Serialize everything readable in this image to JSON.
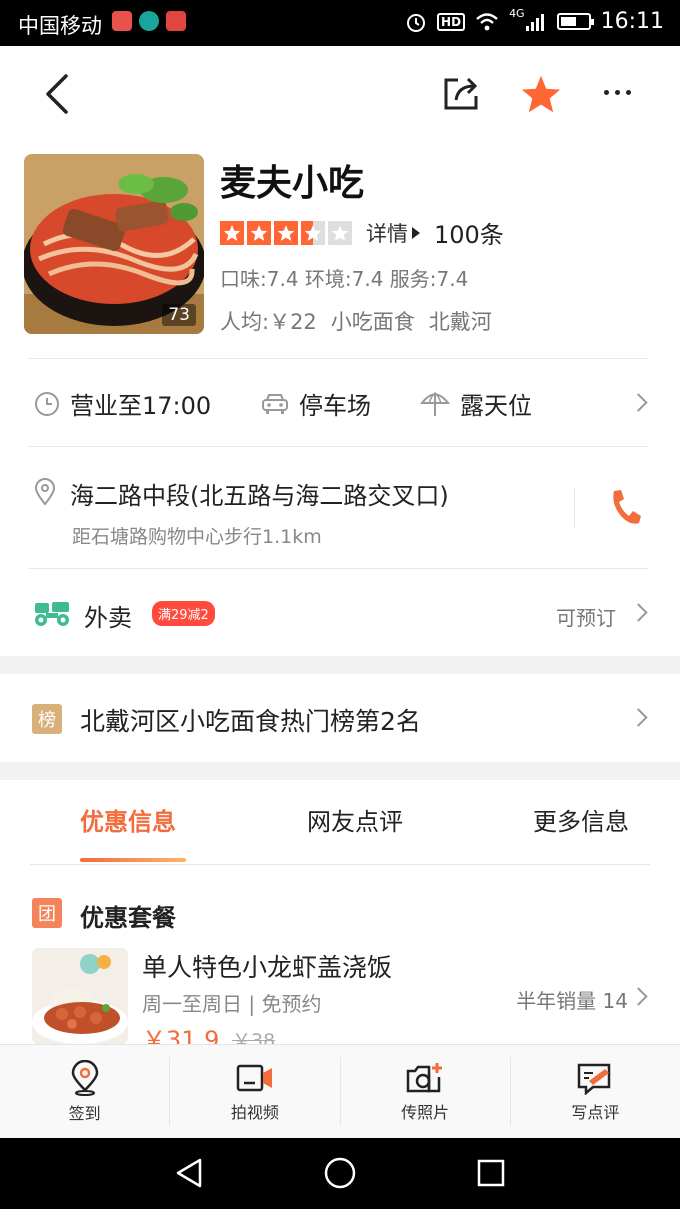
{
  "status_bar": {
    "carrier": "中国移动",
    "hd": "HD",
    "network": "4G",
    "time": "16:11",
    "battery_level": 0.6
  },
  "nav": {
    "back_icon": "chevron-left-icon",
    "share_icon": "share-icon",
    "favorite_icon": "star-icon",
    "more_icon": "more-icon",
    "accent": "#ff6633"
  },
  "shop": {
    "name": "麦夫小吃",
    "photo_count": "73",
    "rating_stars": 3.5,
    "detail_label": "详情",
    "review_count": "100条",
    "scores": "口味:7.4 环境:7.4 服务:7.4",
    "avg_price": "人均:￥22",
    "category": "小吃面食",
    "district": "北戴河"
  },
  "features": {
    "hours": "营业至17:00",
    "parking": "停车场",
    "outdoor": "露天位"
  },
  "address": {
    "main": "海二路中段(北五路与海二路交叉口)",
    "distance": "距石塘路购物中心步行1.1km"
  },
  "delivery": {
    "label": "外卖",
    "promo": "满29减2",
    "reserve": "可预订"
  },
  "ranking": {
    "icon_text": "榜",
    "text": "北戴河区小吃面食热门榜第2名"
  },
  "tabs": [
    {
      "label": "优惠信息"
    },
    {
      "label": "网友点评"
    },
    {
      "label": "更多信息"
    }
  ],
  "deals": {
    "icon_text": "团",
    "title": "优惠套餐",
    "item": {
      "name": "单人特色小龙虾盖浇饭",
      "subtitle": "周一至周日 | 免预约",
      "sales": "半年销量 14",
      "price": "￥31.9",
      "original_price": "￥38"
    }
  },
  "actions": [
    {
      "label": "签到",
      "icon": "location-pin-icon"
    },
    {
      "label": "拍视频",
      "icon": "video-camera-icon"
    },
    {
      "label": "传照片",
      "icon": "photo-camera-plus-icon"
    },
    {
      "label": "写点评",
      "icon": "write-review-icon"
    }
  ]
}
